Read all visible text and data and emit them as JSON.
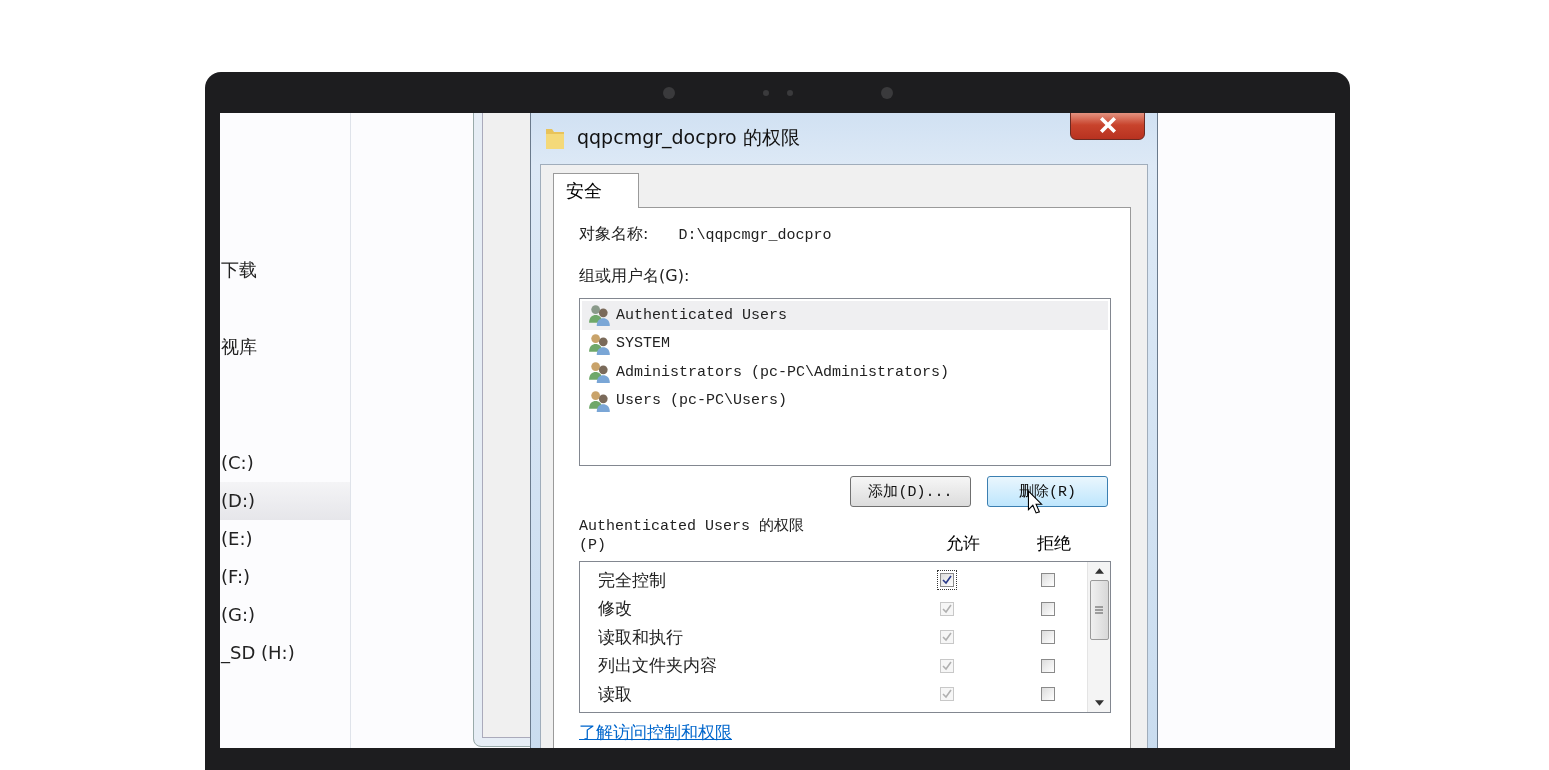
{
  "sidebar": {
    "items": [
      {
        "label": "下载",
        "selected": false
      },
      {
        "label": "视库",
        "selected": false
      },
      {
        "label": "(C:)",
        "selected": false
      },
      {
        "label": "(D:)",
        "selected": true
      },
      {
        "label": "(E:)",
        "selected": false
      },
      {
        "label": "(F:)",
        "selected": false
      },
      {
        "label": "(G:)",
        "selected": false
      },
      {
        "label": "_SD (H:)",
        "selected": false
      }
    ]
  },
  "dialog": {
    "title": "qqpcmgr_docpro 的权限",
    "tabs": [
      {
        "label": "安全",
        "selected": true
      }
    ],
    "object_name_label": "对象名称:",
    "object_name": "D:\\qqpcmgr_docpro",
    "groups_label": "组或用户名(G):",
    "users": [
      {
        "name": "Authenticated Users",
        "selected": true
      },
      {
        "name": "SYSTEM",
        "selected": false
      },
      {
        "name": "Administrators (pc-PC\\Administrators)",
        "selected": false
      },
      {
        "name": "Users (pc-PC\\Users)",
        "selected": false
      }
    ],
    "buttons": [
      {
        "label": "添加(D)...",
        "hovered": false
      },
      {
        "label": "删除(R)",
        "hovered": true
      }
    ],
    "permissions_label": "Authenticated Users 的权限",
    "permissions_label_key": "(P)",
    "columns": [
      "允许",
      "拒绝"
    ],
    "permissions": [
      {
        "name": "完全控制",
        "allow": true,
        "allow_disabled": false,
        "deny": false
      },
      {
        "name": "修改",
        "allow": true,
        "allow_disabled": true,
        "deny": false
      },
      {
        "name": "读取和执行",
        "allow": true,
        "allow_disabled": true,
        "deny": false
      },
      {
        "name": "列出文件夹内容",
        "allow": true,
        "allow_disabled": true,
        "deny": false
      },
      {
        "name": "读取",
        "allow": true,
        "allow_disabled": true,
        "deny": false
      }
    ],
    "link": "了解访问控制和权限"
  }
}
